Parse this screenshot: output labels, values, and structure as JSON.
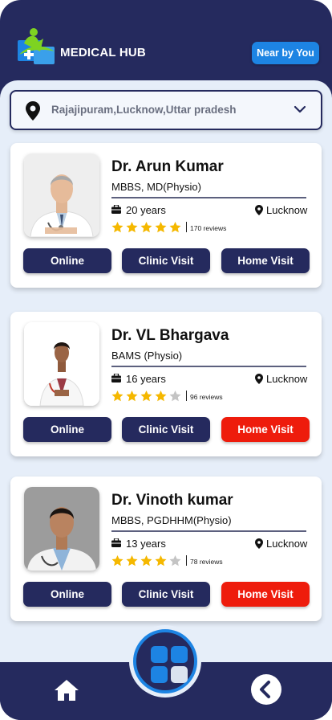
{
  "app": {
    "brand": "MEDICAL HUB",
    "nearby_label": "Near by You"
  },
  "location": {
    "value": "Rajajipuram,Lucknow,Uttar pradesh"
  },
  "doctors": [
    {
      "name": "Dr. Arun Kumar",
      "qualification": "MBBS, MD(Physio)",
      "experience": "20 years",
      "city": "Lucknow",
      "rating": 5,
      "reviews": "170 reviews",
      "buttons": {
        "online": "Online",
        "clinic": "Clinic Visit",
        "home": "Home Visit"
      }
    },
    {
      "name": "Dr. VL Bhargava",
      "qualification": "BAMS (Physio)",
      "experience": "16 years",
      "city": "Lucknow",
      "rating": 4,
      "reviews": "96 reviews",
      "buttons": {
        "online": "Online",
        "clinic": "Clinic Visit",
        "home": "Home Visit"
      }
    },
    {
      "name": "Dr. Vinoth kumar",
      "qualification": "MBBS, PGDHHM(Physio)",
      "experience": "13 years",
      "city": "Lucknow",
      "rating": 4,
      "reviews": "78 reviews",
      "buttons": {
        "online": "Online",
        "clinic": "Clinic Visit",
        "home": "Home Visit"
      }
    }
  ],
  "colors": {
    "navy": "#252a5e",
    "accent_blue": "#1d84e3",
    "home_visit_active": "#ee1c0c",
    "star": "#f5b800",
    "background": "#e6eef9"
  },
  "icons": {
    "logo": "medical-hub-logo",
    "location": "map-pin-icon",
    "dropdown": "chevron-down-icon",
    "experience": "briefcase-icon",
    "city": "location-marker-icon",
    "home": "home-icon",
    "menu": "grid-icon",
    "back": "back-arrow-icon"
  }
}
